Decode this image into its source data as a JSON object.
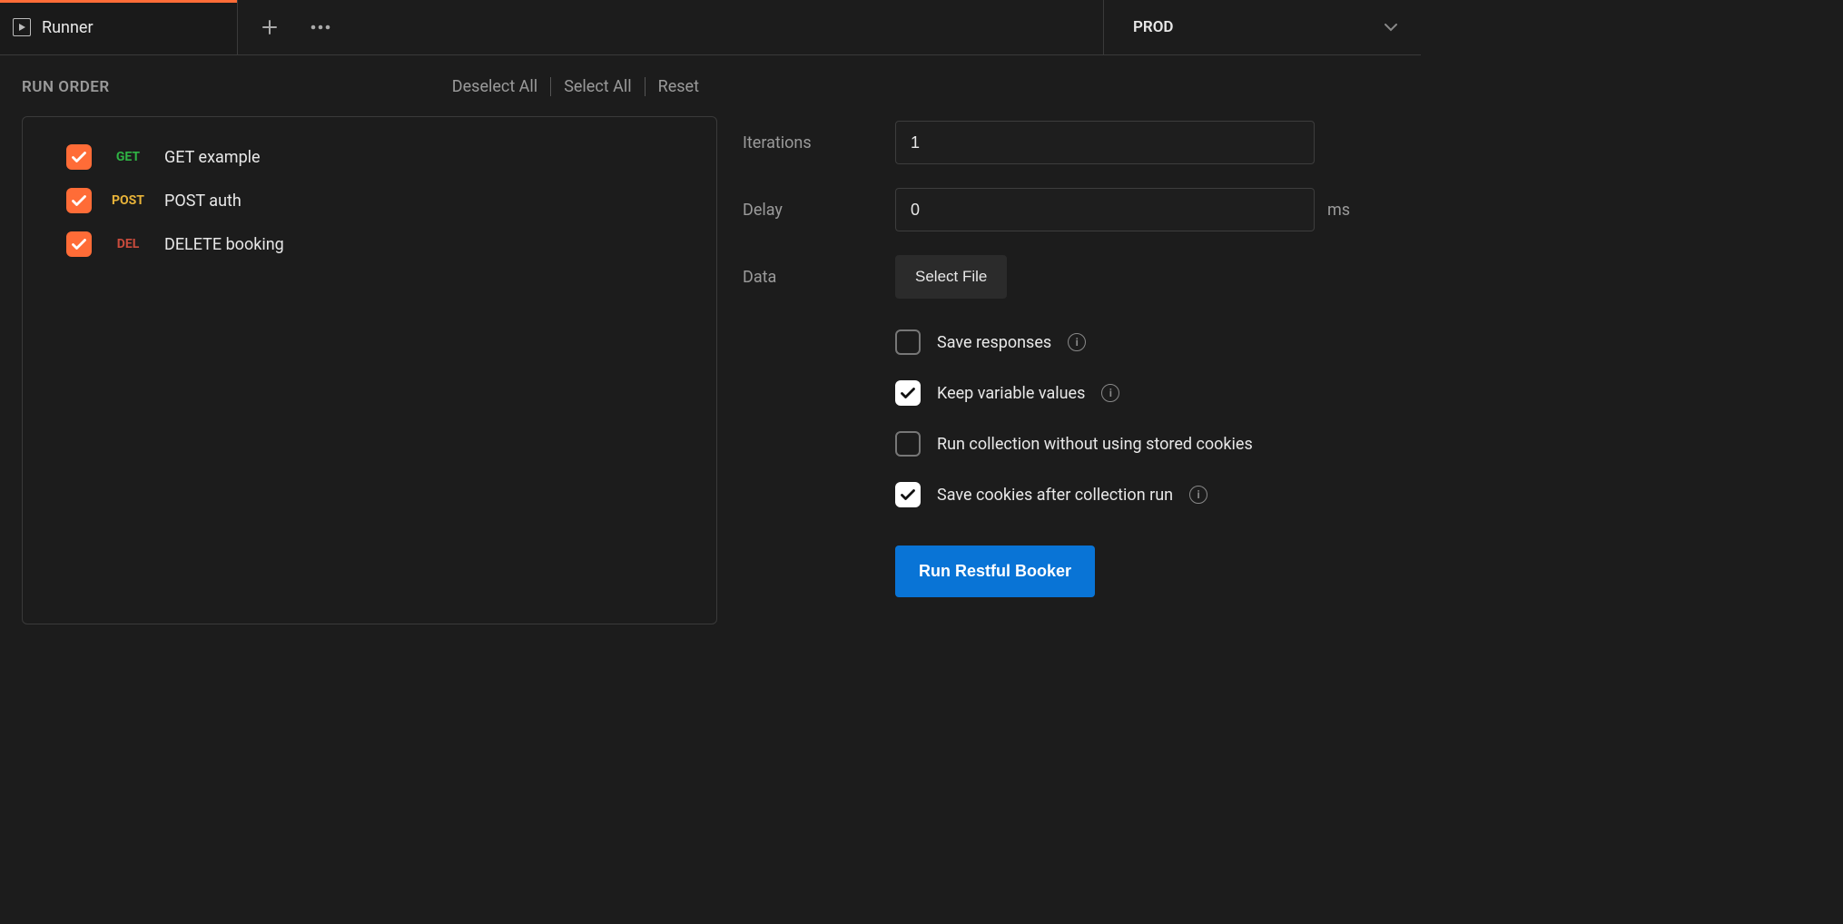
{
  "tab": {
    "label": "Runner"
  },
  "environment": {
    "selected": "PROD"
  },
  "runOrder": {
    "heading": "RUN ORDER",
    "actions": {
      "deselectAll": "Deselect All",
      "selectAll": "Select All",
      "reset": "Reset"
    },
    "items": [
      {
        "method": "GET",
        "methodClass": "get",
        "name": "GET example",
        "checked": true
      },
      {
        "method": "POST",
        "methodClass": "post",
        "name": "POST auth",
        "checked": true
      },
      {
        "method": "DEL",
        "methodClass": "del",
        "name": "DELETE booking",
        "checked": true
      }
    ]
  },
  "settings": {
    "iterations": {
      "label": "Iterations",
      "value": "1"
    },
    "delay": {
      "label": "Delay",
      "value": "0",
      "unit": "ms"
    },
    "data": {
      "label": "Data",
      "button": "Select File"
    },
    "options": {
      "saveResponses": {
        "label": "Save responses",
        "checked": false,
        "info": true
      },
      "keepVarValues": {
        "label": "Keep variable values",
        "checked": true,
        "info": true
      },
      "noStoredCookies": {
        "label": "Run collection without using stored cookies",
        "checked": false,
        "info": false
      },
      "saveCookiesAfter": {
        "label": "Save cookies after collection run",
        "checked": true,
        "info": true
      }
    }
  },
  "runButton": "Run Restful Booker"
}
